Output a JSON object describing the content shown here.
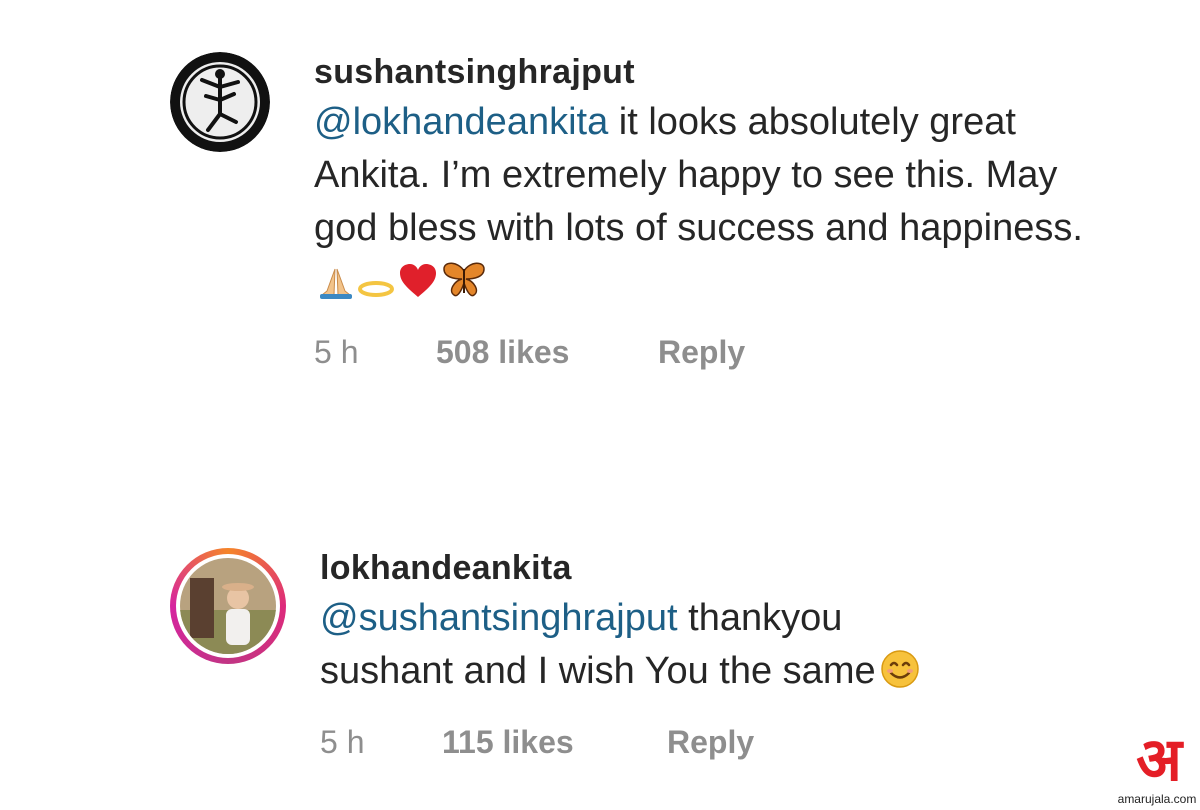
{
  "comments": [
    {
      "username": "sushantsinghrajput",
      "mention": "@lokhandeankita",
      "text_line1": " it looks absolutely",
      "text_rest": "great Ankita. I’m extremely happy to see this. May god bless with lots of success and happiness.",
      "emojis": [
        "folded-hands",
        "halo",
        "red-heart",
        "butterfly"
      ],
      "time": "5 h",
      "likes": "508 likes",
      "reply": "Reply"
    },
    {
      "username": "lokhandeankita",
      "mention": "@sushantsinghrajput",
      "text_line1": " thankyou",
      "text_rest": "sushant and I wish You the same",
      "emojis": [
        "smiling-face"
      ],
      "time": "5 h",
      "likes": "115 likes",
      "reply": "Reply"
    }
  ],
  "watermark": {
    "logo_text": "अ",
    "site": "amarujala.com",
    "brand_color": "#e41e26"
  }
}
